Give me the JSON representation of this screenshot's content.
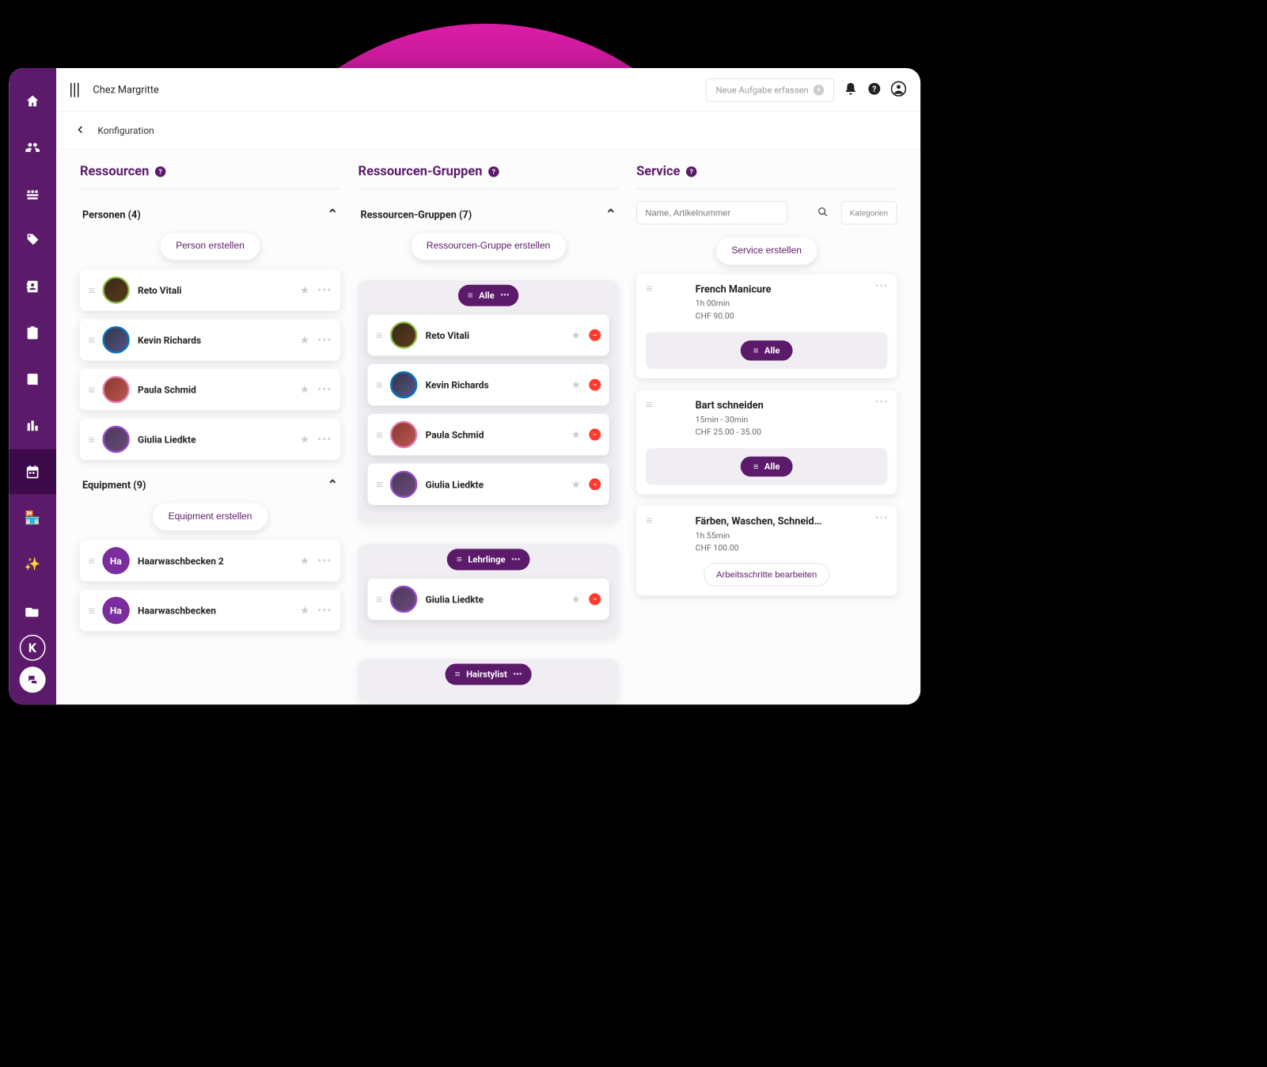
{
  "header": {
    "shop_name": "Chez Margritte",
    "new_task_label": "Neue Aufgabe erfassen"
  },
  "breadcrumb": "Konfiguration",
  "columns": {
    "resources": {
      "title": "Ressourcen",
      "persons_header": "Personen (4)",
      "create_person": "Person erstellen",
      "persons": [
        {
          "name": "Reto Vitali",
          "ring": "green"
        },
        {
          "name": "Kevin Richards",
          "ring": "blue"
        },
        {
          "name": "Paula Schmid",
          "ring": "pink"
        },
        {
          "name": "Giulia Liedkte",
          "ring": "purple"
        }
      ],
      "equipment_header": "Equipment (9)",
      "create_equipment": "Equipment erstellen",
      "equipment": [
        {
          "name": "Haarwaschbecken 2",
          "initials": "Ha"
        },
        {
          "name": "Haarwaschbecken",
          "initials": "Ha"
        }
      ]
    },
    "groups": {
      "title": "Ressourcen-Gruppen",
      "header": "Ressourcen-Gruppen (7)",
      "create": "Ressourcen-Gruppe erstellen",
      "items": [
        {
          "name": "Alle",
          "members": [
            {
              "name": "Reto Vitali",
              "ring": "green"
            },
            {
              "name": "Kevin Richards",
              "ring": "blue"
            },
            {
              "name": "Paula Schmid",
              "ring": "pink"
            },
            {
              "name": "Giulia Liedkte",
              "ring": "purple"
            }
          ]
        },
        {
          "name": "Lehrlinge",
          "members": [
            {
              "name": "Giulia Liedkte",
              "ring": "purple"
            }
          ]
        },
        {
          "name": "Hairstylist",
          "members": []
        }
      ]
    },
    "services": {
      "title": "Service",
      "search_placeholder": "Name, Artikelnummer",
      "categories_label": "Kategorien",
      "create": "Service erstellen",
      "step_chip": "Alle",
      "edit_steps": "Arbeitsschritte bearbeiten",
      "items": [
        {
          "name": "French Manicure",
          "duration": "1h 00min",
          "price": "CHF 90.00"
        },
        {
          "name": "Bart schneiden",
          "duration": "15min - 30min",
          "price": "CHF 25.00 - 35.00"
        },
        {
          "name": "Färben, Waschen, Schneid…",
          "duration": "1h 55min",
          "price": "CHF 100.00"
        }
      ]
    }
  }
}
